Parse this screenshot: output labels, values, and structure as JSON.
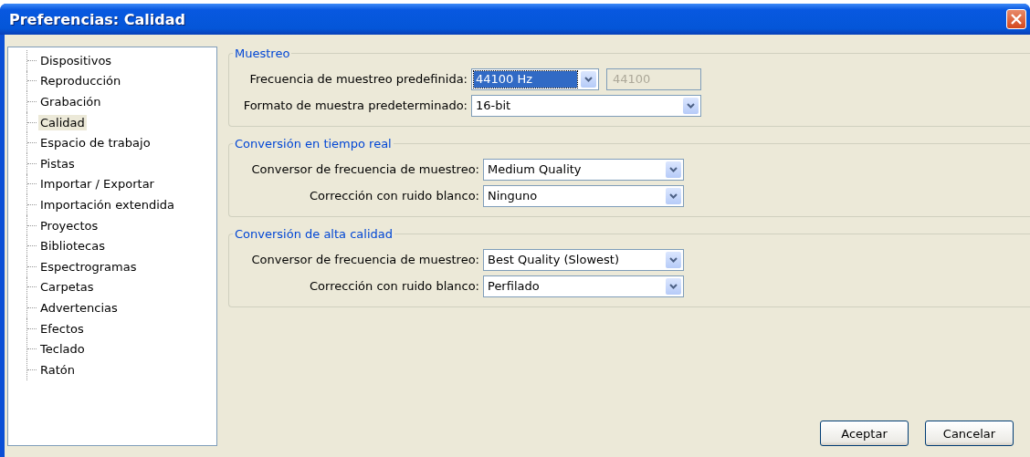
{
  "window": {
    "title": "Preferencias: Calidad"
  },
  "sidebar": {
    "items": [
      {
        "label": "Dispositivos",
        "selected": false
      },
      {
        "label": "Reproducción",
        "selected": false
      },
      {
        "label": "Grabación",
        "selected": false
      },
      {
        "label": "Calidad",
        "selected": true
      },
      {
        "label": "Espacio de trabajo",
        "selected": false
      },
      {
        "label": "Pistas",
        "selected": false
      },
      {
        "label": "Importar / Exportar",
        "selected": false
      },
      {
        "label": "Importación extendida",
        "selected": false
      },
      {
        "label": "Proyectos",
        "selected": false
      },
      {
        "label": "Bibliotecas",
        "selected": false
      },
      {
        "label": "Espectrogramas",
        "selected": false
      },
      {
        "label": "Carpetas",
        "selected": false
      },
      {
        "label": "Advertencias",
        "selected": false
      },
      {
        "label": "Efectos",
        "selected": false
      },
      {
        "label": "Teclado",
        "selected": false
      },
      {
        "label": "Ratón",
        "selected": false
      }
    ]
  },
  "groups": [
    {
      "title": "Muestreo",
      "rows": [
        {
          "label": "Frecuencia de muestreo predefinida:",
          "value": "44100 Hz",
          "focused": true,
          "extra_field": {
            "value": "44100",
            "disabled": true
          }
        },
        {
          "label": "Formato de muestra predeterminado:",
          "value": "16-bit",
          "focused": false
        }
      ]
    },
    {
      "title": "Conversión en tiempo real",
      "rows": [
        {
          "label": "Conversor de frecuencia de muestreo:",
          "value": "Medium Quality",
          "focused": false
        },
        {
          "label": "Corrección con ruido blanco:",
          "value": "Ninguno",
          "focused": false
        }
      ]
    },
    {
      "title": "Conversión de alta calidad",
      "rows": [
        {
          "label": "Conversor de frecuencia de muestreo:",
          "value": "Best Quality (Slowest)",
          "focused": false
        },
        {
          "label": "Corrección con ruido blanco:",
          "value": "Perfilado",
          "focused": false
        }
      ]
    }
  ],
  "buttons": [
    "Aceptar",
    "Cancelar"
  ]
}
